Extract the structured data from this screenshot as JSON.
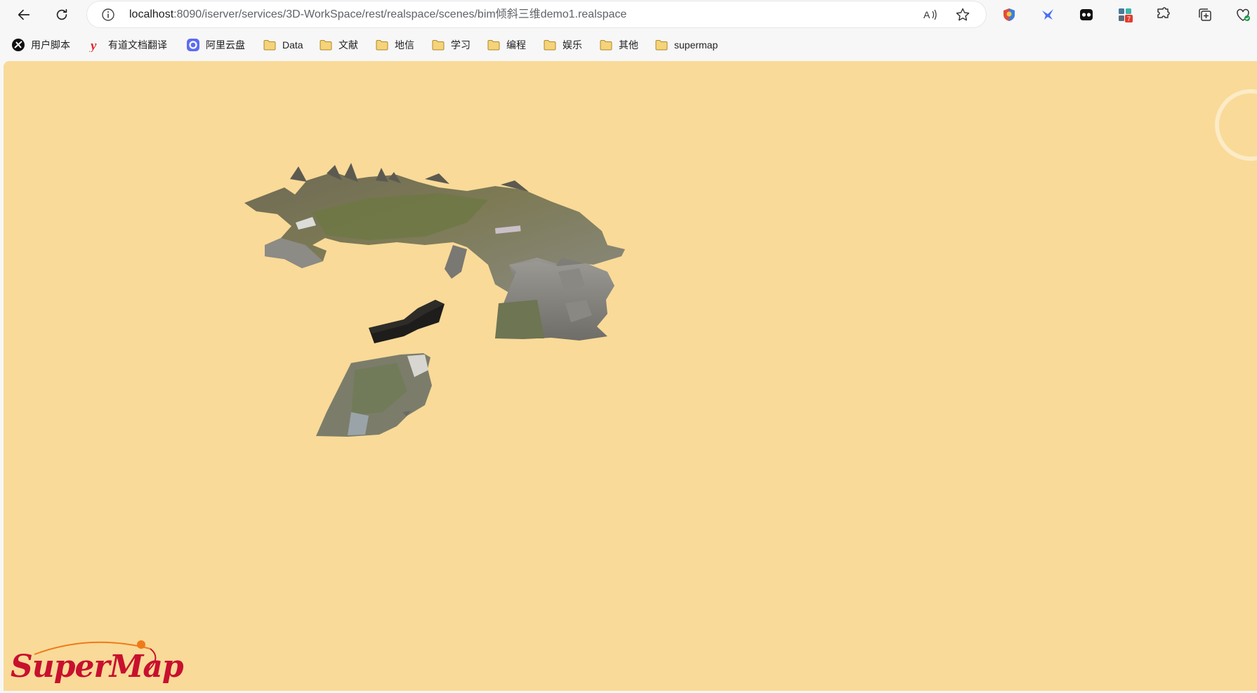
{
  "browser": {
    "url_host": "localhost",
    "url_path": ":8090/iserver/services/3D-WorkSpace/rest/realspace/scenes/bim倾斜三维demo1.realspace",
    "nav": {
      "back_icon": "back-arrow-icon",
      "reload_icon": "reload-icon"
    },
    "extensions": [
      {
        "name": "shield-extension-icon",
        "color": "#e24a3b"
      },
      {
        "name": "fly-extension-icon",
        "color": "#4a6cf7"
      },
      {
        "name": "mask-extension-icon",
        "color": "#111111"
      },
      {
        "name": "grid-extension-icon",
        "badge": "7"
      },
      {
        "name": "puzzle-extensions-icon"
      },
      {
        "name": "collections-icon"
      },
      {
        "name": "performance-icon"
      }
    ]
  },
  "bookmarks": [
    {
      "label": "用户脚本",
      "icon": "userscript-icon"
    },
    {
      "label": "有道文档翻译",
      "icon": "youdao-icon"
    },
    {
      "label": "阿里云盘",
      "icon": "aliyun-drive-icon"
    },
    {
      "label": "Data",
      "icon": "folder-icon"
    },
    {
      "label": "文献",
      "icon": "folder-icon"
    },
    {
      "label": "地信",
      "icon": "folder-icon"
    },
    {
      "label": "学习",
      "icon": "folder-icon"
    },
    {
      "label": "编程",
      "icon": "folder-icon"
    },
    {
      "label": "娱乐",
      "icon": "folder-icon"
    },
    {
      "label": "其他",
      "icon": "folder-icon"
    },
    {
      "label": "supermap",
      "icon": "folder-icon"
    }
  ],
  "scene": {
    "background_color": "#f9da98",
    "logo_text": "SuperMap",
    "logo_color": "#c8102e",
    "logo_accent": "#f07a1a"
  }
}
